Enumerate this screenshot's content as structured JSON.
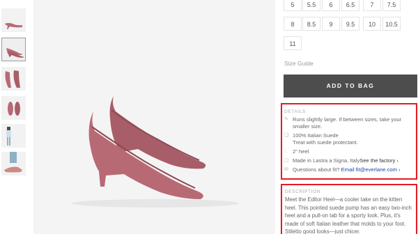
{
  "sizes": [
    "5",
    "5.5",
    "6",
    "6.5",
    "7",
    "7.5",
    "8",
    "8.5",
    "9",
    "9.5",
    "10",
    "10.5",
    "11"
  ],
  "size_guide_label": "Size Guide",
  "add_to_bag_label": "ADD TO BAG",
  "details": {
    "heading": "DETAILS",
    "fit": "Runs slightly large. If between sizes, take your smaller size.",
    "material": "100% Italian Suede",
    "care": "Treat with suede protectant.",
    "heel": "2\" heel",
    "origin": "Made in Lastra a Signa, Italy",
    "factory_link": "See the factory",
    "fit_question": "Questions about fit?",
    "email": "Email fit@everlane.com"
  },
  "description": {
    "heading": "DESCRIPTION",
    "text": "Meet the Editor Heel—a cooler take on the kitten heel. This pointed suede pump has an easy two-inch heel and a pull-on tab for a sporty look. Plus, it's made of soft Italian leather that molds to your foot. Stiletto good looks—just chicer."
  },
  "colors": {
    "shoe": "#b86a74",
    "shoe_dark": "#8e4a53",
    "button": "#4d4d4d",
    "highlight": "#e31b23"
  }
}
